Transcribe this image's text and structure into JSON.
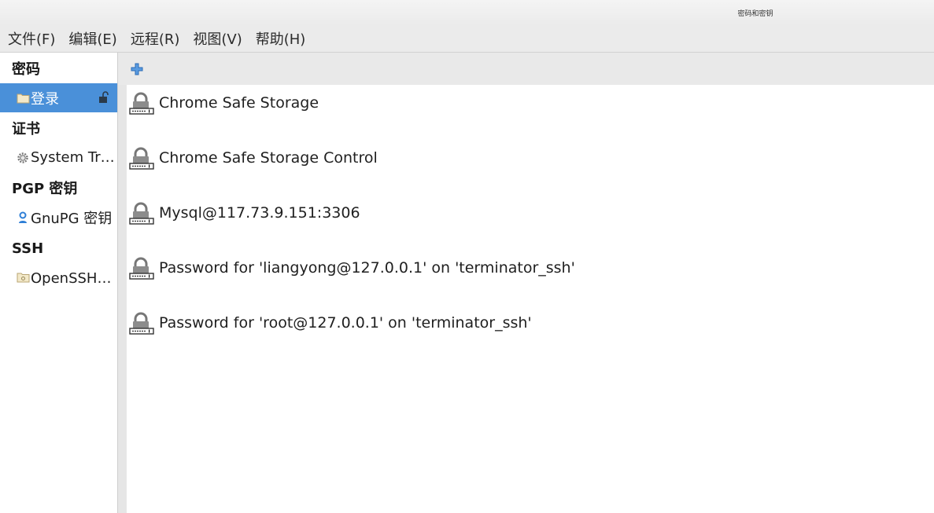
{
  "window": {
    "title": "密码和密钥"
  },
  "menu": [
    {
      "label": "文件(F)"
    },
    {
      "label": "编辑(E)"
    },
    {
      "label": "远程(R)"
    },
    {
      "label": "视图(V)"
    },
    {
      "label": "帮助(H)"
    }
  ],
  "sidebar": {
    "sections": [
      {
        "header": "密码",
        "items": [
          {
            "label": "登录",
            "icon": "folder-icon",
            "selected": true,
            "unlocked": true
          }
        ]
      },
      {
        "header": "证书",
        "items": [
          {
            "label": "System Trust",
            "icon": "gear-icon"
          }
        ]
      },
      {
        "header": "PGP 密钥",
        "items": [
          {
            "label": "GnuPG 密钥",
            "icon": "key-person-icon"
          }
        ]
      },
      {
        "header": "SSH",
        "items": [
          {
            "label": "OpenSSH 密钥",
            "icon": "folder-icon"
          }
        ]
      }
    ]
  },
  "toolbar": {
    "add_icon": "add-icon"
  },
  "entries": [
    {
      "label": "Chrome Safe Storage",
      "icon": "password-lock-icon"
    },
    {
      "label": "Chrome Safe Storage Control",
      "icon": "password-lock-icon"
    },
    {
      "label": "Mysql@117.73.9.151:3306",
      "icon": "password-lock-icon"
    },
    {
      "label": "Password for 'liangyong@127.0.0.1' on 'terminator_ssh'",
      "icon": "password-lock-icon"
    },
    {
      "label": "Password for 'root@127.0.0.1' on 'terminator_ssh'",
      "icon": "password-lock-icon"
    }
  ],
  "colors": {
    "selection": "#4a90d9",
    "add": "#3b7cc9"
  }
}
